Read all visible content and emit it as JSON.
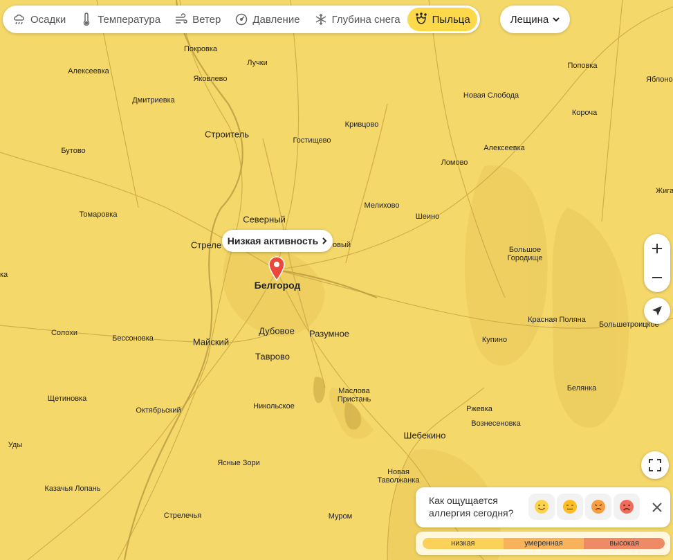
{
  "layers": [
    {
      "label": "Осадки",
      "icon": "cloud-rain-icon",
      "active": false
    },
    {
      "label": "Температура",
      "icon": "thermometer-icon",
      "active": false
    },
    {
      "label": "Ветер",
      "icon": "wind-icon",
      "active": false
    },
    {
      "label": "Давление",
      "icon": "gauge-icon",
      "active": false
    },
    {
      "label": "Глубина снега",
      "icon": "snowflake-icon",
      "active": false
    },
    {
      "label": "Пыльца",
      "icon": "pollen-flower-icon",
      "active": true
    }
  ],
  "plant_select": {
    "value": "Лещина"
  },
  "callout": {
    "label": "Низкая активность"
  },
  "places": {
    "pokrovka": "Покровка",
    "luchki": "Лучки",
    "alekseevka_w": "Алексеевка",
    "yakovlevo": "Яковлево",
    "popovka": "Поповка",
    "yablono": "Яблоно",
    "dmitrievka": "Дмитриевка",
    "novaya_sloboda": "Новая Слобода",
    "korocha": "Короча",
    "stroitel": "Строитель",
    "krivtsovo": "Кривцово",
    "gostishchevo": "Гостищево",
    "butovo": "Бутово",
    "alekseevka_e": "Алексеевка",
    "lomovo": "Ломово",
    "zhiga": "Жига",
    "melikhovo": "Мелихово",
    "tomarovka": "Томаровка",
    "sheino": "Шеино",
    "severny": "Северный",
    "strelets": "Стреле",
    "dovy": "овый",
    "bolshoe_gorodishche_1": "Большое",
    "bolshoe_gorodishche_2": "Городище",
    "ka": "ка",
    "belgorod": "Белгород",
    "krasnaya_polyana": "Красная Поляна",
    "bolshetroitskoe": "Большетроицкое",
    "dubovoe": "Дубовое",
    "solokhi": "Солохи",
    "bessonovka": "Бессоновка",
    "maysky": "Майский",
    "razumnoe": "Разумное",
    "kupino": "Купино",
    "tavrovo": "Таврово",
    "belyanka": "Белянка",
    "maslova_1": "Маслова",
    "maslova_2": "Пристань",
    "shchetinovka": "Щетиновка",
    "oktyabrsky": "Октябрьский",
    "nikolskoe": "Никольское",
    "rzhevka": "Ржевка",
    "voznesenovka": "Вознесеновка",
    "shebekino": "Шебекино",
    "udy": "Уды",
    "yasnye_zori": "Ясные Зори",
    "novaya_tav_1": "Новая",
    "novaya_tav_2": "Таволжанка",
    "kazachya_lopan": "Казачья Лопань",
    "strelechya": "Стрелечья",
    "murom": "Муром"
  },
  "feel_card": {
    "question": "Как ощущается аллергия сегодня?",
    "faces": [
      "happy-face-icon",
      "neutral-face-icon",
      "uneasy-face-icon",
      "sad-face-icon"
    ]
  },
  "legend": {
    "levels": [
      {
        "label": "низкая",
        "color": "#fbd15a"
      },
      {
        "label": "умеренная",
        "color": "#f7b25c"
      },
      {
        "label": "высокая",
        "color": "#ef8a66"
      }
    ]
  },
  "colors": {
    "map_fill": "#f5d86a",
    "accent": "#fbd94a",
    "pin": "#e9483a"
  }
}
